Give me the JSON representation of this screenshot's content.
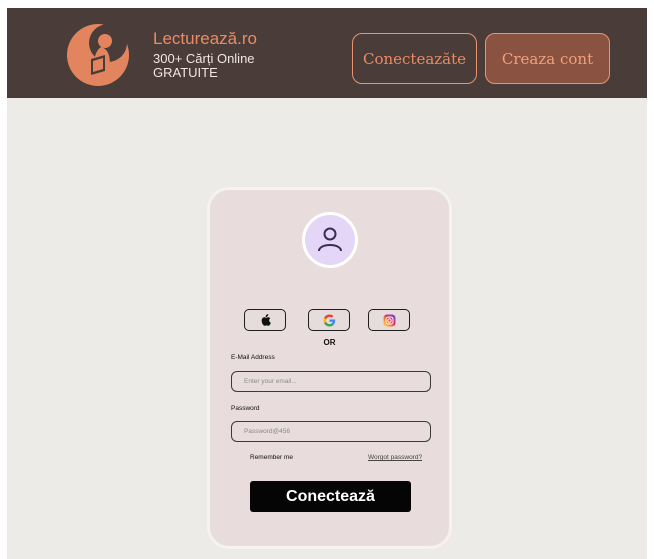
{
  "header": {
    "brand_name": "Lecturează.ro",
    "tagline": "300+ Cărți Online GRATUITE",
    "login_button": "Conecteazăte",
    "register_button": "Creaza cont"
  },
  "login_card": {
    "social_buttons": [
      {
        "icon": "apple-icon"
      },
      {
        "icon": "google-icon"
      },
      {
        "icon": "instagram-icon"
      }
    ],
    "separator": "OR",
    "email": {
      "label": "E-Mail Address",
      "placeholder": "Enter your email...",
      "value": ""
    },
    "password": {
      "label": "Password",
      "placeholder": "Password@456",
      "value": ""
    },
    "remember_me": "Remember me",
    "forgot_password": "Worgot password?",
    "submit_button": "Conectează"
  },
  "colors": {
    "header_bg": "#4a3c38",
    "accent": "#ec8b63",
    "page_bg": "#edebe7",
    "card_bg": "#e8dcdc",
    "submit_bg": "#050505"
  }
}
